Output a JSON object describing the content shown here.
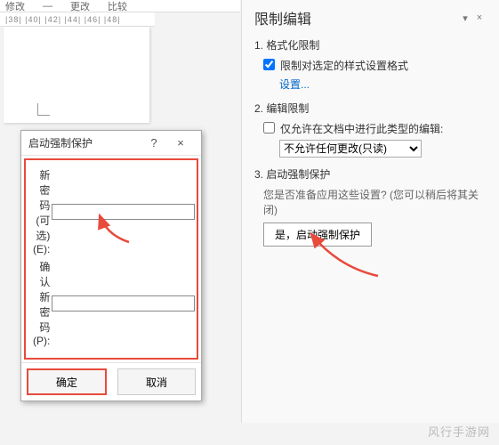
{
  "topTabs": {
    "t1": "修改",
    "t2": "—",
    "t3": "更改",
    "t4": "比较"
  },
  "ruler": "|38|  |40|  |42|  |44|  |46|  |48|",
  "dialog": {
    "title": "启动强制保护",
    "row1": "新密码(可选)(E):",
    "row2": "确认新密码(P):",
    "ok": "确定",
    "cancel": "取消",
    "help": "?",
    "close": "×"
  },
  "panel": {
    "title": "限制编辑",
    "nav_down": "▾",
    "nav_close": "×",
    "sec1": "1. 格式化限制",
    "chk1": "限制对选定的样式设置格式",
    "link1": "设置...",
    "sec2": "2. 编辑限制",
    "chk2": "仅允许在文档中进行此类型的编辑:",
    "select_val": "不允许任何更改(只读)",
    "sec3": "3. 启动强制保护",
    "desc3": "您是否准备应用这些设置? (您可以稍后将其关闭)",
    "btn3": "是，启动强制保护"
  },
  "watermark": "风行手游网"
}
